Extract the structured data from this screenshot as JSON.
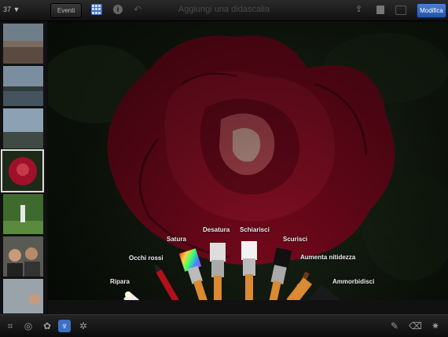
{
  "topbar": {
    "photo_count": "37 ▼",
    "events_label": "Eventi",
    "title": "Aggiungi una didascalia",
    "edit_label": "Modifica"
  },
  "brushes": [
    {
      "label": "Ripara"
    },
    {
      "label": "Occhi rossi"
    },
    {
      "label": "Satura"
    },
    {
      "label": "Desatura"
    },
    {
      "label": "Schiarisci"
    },
    {
      "label": "Scurisci"
    },
    {
      "label": "Aumenta nitidezza"
    },
    {
      "label": "Ammorbidisci"
    }
  ],
  "colors": {
    "accent": "#3f6fc4",
    "rose": "#a0102a"
  },
  "icons": [
    "crop-icon",
    "adjust-icon",
    "palette-icon",
    "brushes-icon",
    "effects-icon",
    "brush-edit-icon",
    "eraser-icon",
    "settings-icon"
  ]
}
